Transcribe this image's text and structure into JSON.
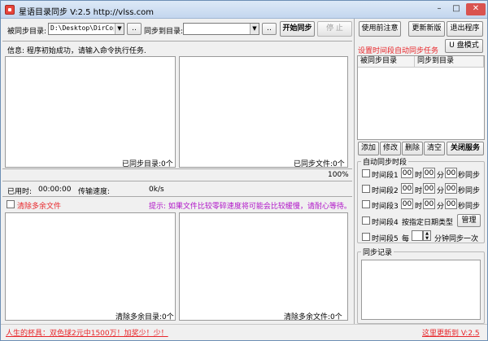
{
  "window": {
    "title": "星语目录同步 V:2.5 http://vlss.com",
    "minimize": "–",
    "maximize": "□",
    "close": "✕"
  },
  "toolbar": {
    "source_label": "被同步目录:",
    "source_value": "D:\\Desktop\\DirCopy",
    "browse_label": "..",
    "target_label": "同步到目录:",
    "target_value": "",
    "start_label": "开始同步",
    "stop_label": "停 止"
  },
  "info_text": "信息: 程序初始成功，请输入命令执行任务.",
  "left_pane": {
    "synced_dirs_label": "已同步目录:0个",
    "synced_files_label": "已同步文件:0个",
    "progress_text": "100%",
    "time_used_label": "已用时:",
    "time_used_value": "00:00:00",
    "speed_label": "传输速度:",
    "speed_value": "0k/s",
    "clear_extra_label": "清除多余文件",
    "hint_text": "提示: 如果文件比较零碎速度将可能会比较缓慢，请耐心等待。",
    "cleared_dirs_label": "清除多余目录:0个",
    "cleared_files_label": "清除多余文件:0个"
  },
  "right_top": {
    "notice_label": "使用前注意",
    "update_label": "更新新版",
    "exit_label": "退出程序",
    "auto_task_text": "设置时间段自动同步任务",
    "udisk_label": "U 盘模式",
    "columns": [
      "被同步目录",
      "同步到目录"
    ],
    "add_label": "添加",
    "edit_label": "修改",
    "delete_label": "删除",
    "clear_label": "清空",
    "close_service_label": "关闭服务"
  },
  "auto_sync": {
    "title": "自动同步时段",
    "slots": [
      {
        "label": "时间段1",
        "h": "00",
        "m": "00",
        "s": "00"
      },
      {
        "label": "时间段2",
        "h": "00",
        "m": "00",
        "s": "00"
      },
      {
        "label": "时间段3",
        "h": "00",
        "m": "00",
        "s": "00"
      }
    ],
    "unit_h": "时",
    "unit_m": "分",
    "unit_s": "秒同步",
    "slot4_label": "时间段4",
    "slot4_text": "按指定日期类型",
    "manage_label": "管理",
    "slot5_label": "时间段5",
    "every_label": "每",
    "slot5_value": "",
    "slot5_suffix": "分钟同步一次"
  },
  "sync_log": {
    "title": "同步记录"
  },
  "footer": {
    "left_text": "人生的杯具：双色球2元中1500万！加奖少！少！",
    "right_text": "这里更新到 V:2.5"
  },
  "colors": {
    "accent_red": "#e8262a",
    "hint_magenta": "#b014c8",
    "link_blue": "#1a43c8"
  }
}
